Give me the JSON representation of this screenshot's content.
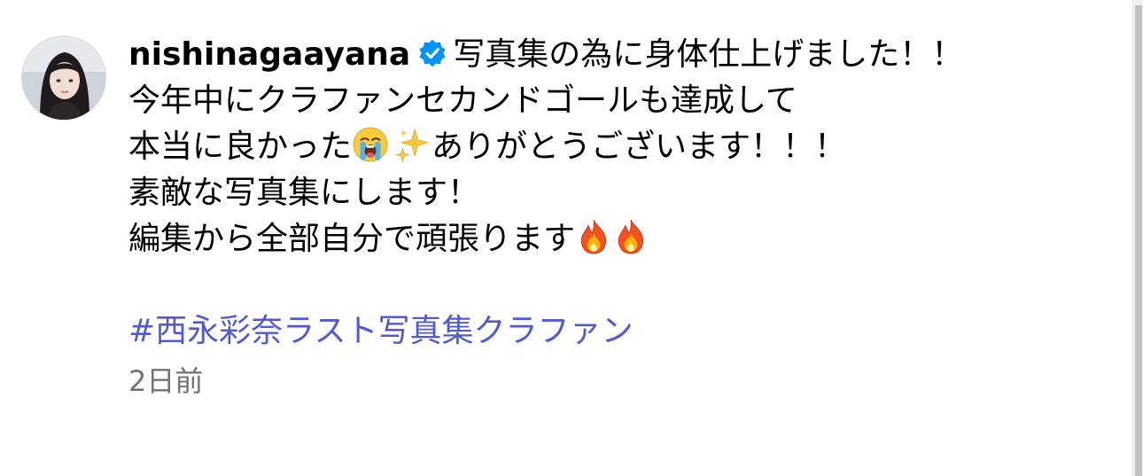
{
  "post": {
    "username": "nishinagaayana",
    "verified": true,
    "caption_lines": [
      "写真集の為に身体仕上げました！！",
      "今年中にクラファンセカンドゴールも達成して",
      "本当に良かった",
      "ありがとうございます！！！",
      "素敵な写真集にします！",
      "編集から全部自分で頑張ります"
    ],
    "hashtag": "#西永彩奈ラスト写真集クラファン",
    "timestamp": "2日前"
  },
  "icons": {
    "avatar": "profile-photo",
    "verified": "verified-badge-icon",
    "emoji_1": "loudly-crying-face-emoji",
    "emoji_2": "sparkles-emoji",
    "emoji_3": "fire-emoji"
  },
  "colors": {
    "hashtag": "#4f5bd5",
    "timestamp": "#737373",
    "verified_badge": "#0095f6"
  }
}
